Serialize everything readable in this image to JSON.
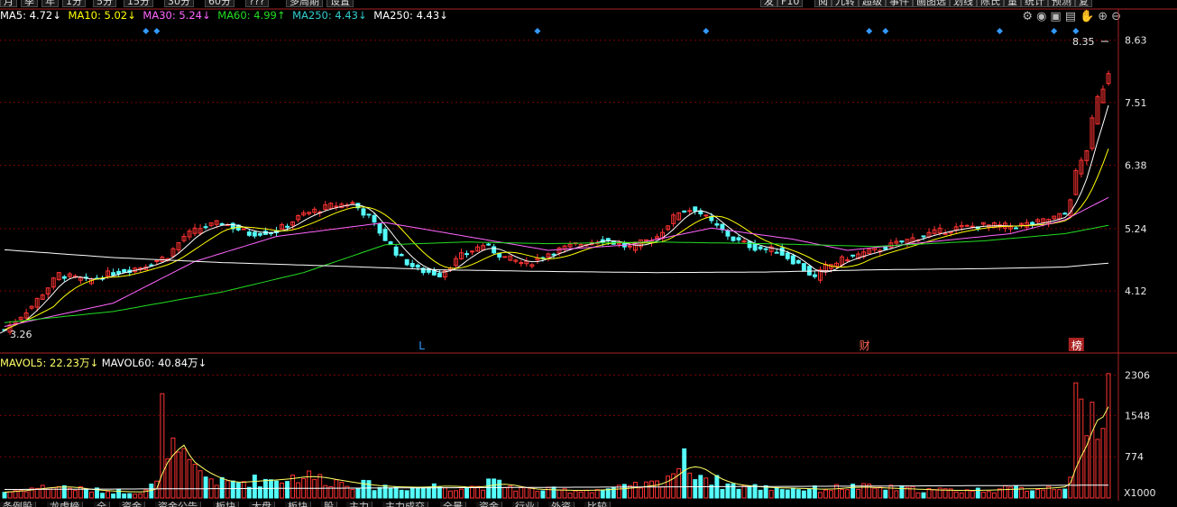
{
  "toolbar": {
    "left": [
      "月",
      "季",
      "年",
      "1分",
      "5分",
      "15分",
      "30分",
      "60分",
      "???",
      "多周期",
      "设置"
    ],
    "right": [
      "发",
      "F10",
      "阅",
      "九转",
      "超级",
      "事件",
      "画图选",
      "划线",
      "陈氏",
      "量",
      "统计",
      "预测",
      "复"
    ]
  },
  "legend": {
    "ma5": {
      "label": "MA5: 4.72↓",
      "color": "#ffffff"
    },
    "ma10": {
      "label": "MA10: 5.02↓",
      "color": "#ffff00"
    },
    "ma30": {
      "label": "MA30: 5.24↓",
      "color": "#ff66ff"
    },
    "ma60": {
      "label": "MA60: 4.99↑",
      "color": "#22dd22"
    },
    "ma250a": {
      "label": "MA250: 4.43↓",
      "color": "#33cccc"
    },
    "ma250b": {
      "label": "MA250: 4.43↓",
      "color": "#ffffff"
    }
  },
  "volume_legend": {
    "mavol5": {
      "label": "MAVOL5: 22.23万↓",
      "color": "#ffff66"
    },
    "mavol60": {
      "label": "MAVOL60: 40.84万↓",
      "color": "#ffffff"
    }
  },
  "icons": [
    "settings-icon",
    "eye-icon",
    "lock-icon",
    "calendar-icon",
    "hand-icon",
    "plus-icon",
    "minus-icon"
  ],
  "bottom_tabs": [
    "条例股",
    "龙虎榜",
    "全",
    "资金",
    "资金公告",
    "板块",
    "大盘",
    "板块",
    "股",
    "主力",
    "主力成交",
    "全景",
    "资金",
    "行业",
    "外资",
    "比较"
  ],
  "colors": {
    "up": "#ff3232",
    "down": "#54fcfc",
    "grid": "#7a0000",
    "axis": "#aa2222",
    "label": "#e8e8e8"
  },
  "chart_data": {
    "type": "candlestick",
    "price_ticks": [
      "8.63",
      "7.51",
      "6.38",
      "5.24",
      "4.12"
    ],
    "price_ylim": [
      3.1,
      8.9
    ],
    "high_label": "8.35",
    "low_label": "3.26",
    "markers": [
      {
        "text": "L"
      },
      {
        "text": "财"
      },
      {
        "text": "榜"
      }
    ],
    "volume_ticks": [
      "2306",
      "1548",
      "774"
    ],
    "volume_unit": "X1000",
    "volume_ylim": [
      0,
      2450
    ],
    "anchors": {
      "close": [
        [
          0,
          3.42
        ],
        [
          5,
          3.85
        ],
        [
          10,
          4.42
        ],
        [
          15,
          4.3
        ],
        [
          20,
          4.45
        ],
        [
          25,
          4.55
        ],
        [
          30,
          4.75
        ],
        [
          33,
          5.1
        ],
        [
          36,
          5.25
        ],
        [
          40,
          5.35
        ],
        [
          45,
          5.15
        ],
        [
          50,
          5.2
        ],
        [
          55,
          5.5
        ],
        [
          60,
          5.65
        ],
        [
          64,
          5.7
        ],
        [
          67,
          5.45
        ],
        [
          70,
          5.05
        ],
        [
          73,
          4.7
        ],
        [
          76,
          4.5
        ],
        [
          80,
          4.42
        ],
        [
          84,
          4.75
        ],
        [
          88,
          4.95
        ],
        [
          92,
          4.72
        ],
        [
          96,
          4.6
        ],
        [
          100,
          4.8
        ],
        [
          105,
          4.95
        ],
        [
          110,
          5.05
        ],
        [
          115,
          4.9
        ],
        [
          120,
          5.1
        ],
        [
          124,
          5.55
        ],
        [
          127,
          5.6
        ],
        [
          130,
          5.35
        ],
        [
          134,
          5.05
        ],
        [
          138,
          4.9
        ],
        [
          142,
          4.85
        ],
        [
          146,
          4.6
        ],
        [
          149,
          4.35
        ],
        [
          151,
          4.55
        ],
        [
          155,
          4.72
        ],
        [
          160,
          4.85
        ],
        [
          165,
          5.0
        ],
        [
          170,
          5.15
        ],
        [
          175,
          5.25
        ],
        [
          180,
          5.3
        ],
        [
          185,
          5.28
        ],
        [
          190,
          5.35
        ],
        [
          195,
          5.5
        ],
        [
          197,
          6.2
        ],
        [
          199,
          6.7
        ],
        [
          201,
          7.55
        ],
        [
          203,
          8.1
        ]
      ],
      "volume": [
        [
          0,
          110
        ],
        [
          5,
          180
        ],
        [
          10,
          220
        ],
        [
          15,
          150
        ],
        [
          20,
          120
        ],
        [
          25,
          110
        ],
        [
          28,
          270
        ],
        [
          29,
          1500
        ],
        [
          31,
          850
        ],
        [
          35,
          500
        ],
        [
          40,
          280
        ],
        [
          45,
          320
        ],
        [
          50,
          350
        ],
        [
          55,
          420
        ],
        [
          60,
          330
        ],
        [
          65,
          250
        ],
        [
          70,
          210
        ],
        [
          75,
          200
        ],
        [
          80,
          230
        ],
        [
          85,
          190
        ],
        [
          90,
          280
        ],
        [
          95,
          170
        ],
        [
          100,
          150
        ],
        [
          105,
          140
        ],
        [
          110,
          160
        ],
        [
          115,
          200
        ],
        [
          120,
          270
        ],
        [
          125,
          680
        ],
        [
          128,
          450
        ],
        [
          132,
          260
        ],
        [
          138,
          200
        ],
        [
          145,
          180
        ],
        [
          150,
          160
        ],
        [
          155,
          210
        ],
        [
          160,
          190
        ],
        [
          165,
          170
        ],
        [
          170,
          150
        ],
        [
          175,
          140
        ],
        [
          180,
          150
        ],
        [
          185,
          170
        ],
        [
          190,
          180
        ],
        [
          195,
          230
        ],
        [
          196,
          520
        ],
        [
          197,
          1600
        ],
        [
          198,
          1350
        ],
        [
          199,
          1200
        ],
        [
          200,
          1550
        ],
        [
          201,
          1600
        ],
        [
          202,
          1900
        ],
        [
          203,
          2306
        ]
      ]
    },
    "ma_curves": {
      "ma30": [
        [
          0,
          3.48
        ],
        [
          20,
          3.9
        ],
        [
          35,
          4.65
        ],
        [
          50,
          5.1
        ],
        [
          70,
          5.35
        ],
        [
          85,
          5.1
        ],
        [
          100,
          4.85
        ],
        [
          115,
          4.95
        ],
        [
          130,
          5.25
        ],
        [
          145,
          5.05
        ],
        [
          155,
          4.85
        ],
        [
          170,
          5.0
        ],
        [
          185,
          5.15
        ],
        [
          195,
          5.4
        ],
        [
          203,
          5.8
        ]
      ],
      "ma60": [
        [
          0,
          3.55
        ],
        [
          20,
          3.75
        ],
        [
          40,
          4.1
        ],
        [
          55,
          4.45
        ],
        [
          70,
          4.95
        ],
        [
          85,
          5.0
        ],
        [
          100,
          4.97
        ],
        [
          120,
          5.0
        ],
        [
          140,
          4.97
        ],
        [
          160,
          4.92
        ],
        [
          180,
          5.02
        ],
        [
          195,
          5.15
        ],
        [
          203,
          5.3
        ]
      ],
      "ma250": [
        [
          0,
          4.86
        ],
        [
          20,
          4.72
        ],
        [
          40,
          4.63
        ],
        [
          60,
          4.57
        ],
        [
          80,
          4.5
        ],
        [
          100,
          4.47
        ],
        [
          120,
          4.45
        ],
        [
          140,
          4.46
        ],
        [
          160,
          4.5
        ],
        [
          180,
          4.52
        ],
        [
          195,
          4.55
        ],
        [
          203,
          4.62
        ]
      ]
    }
  }
}
